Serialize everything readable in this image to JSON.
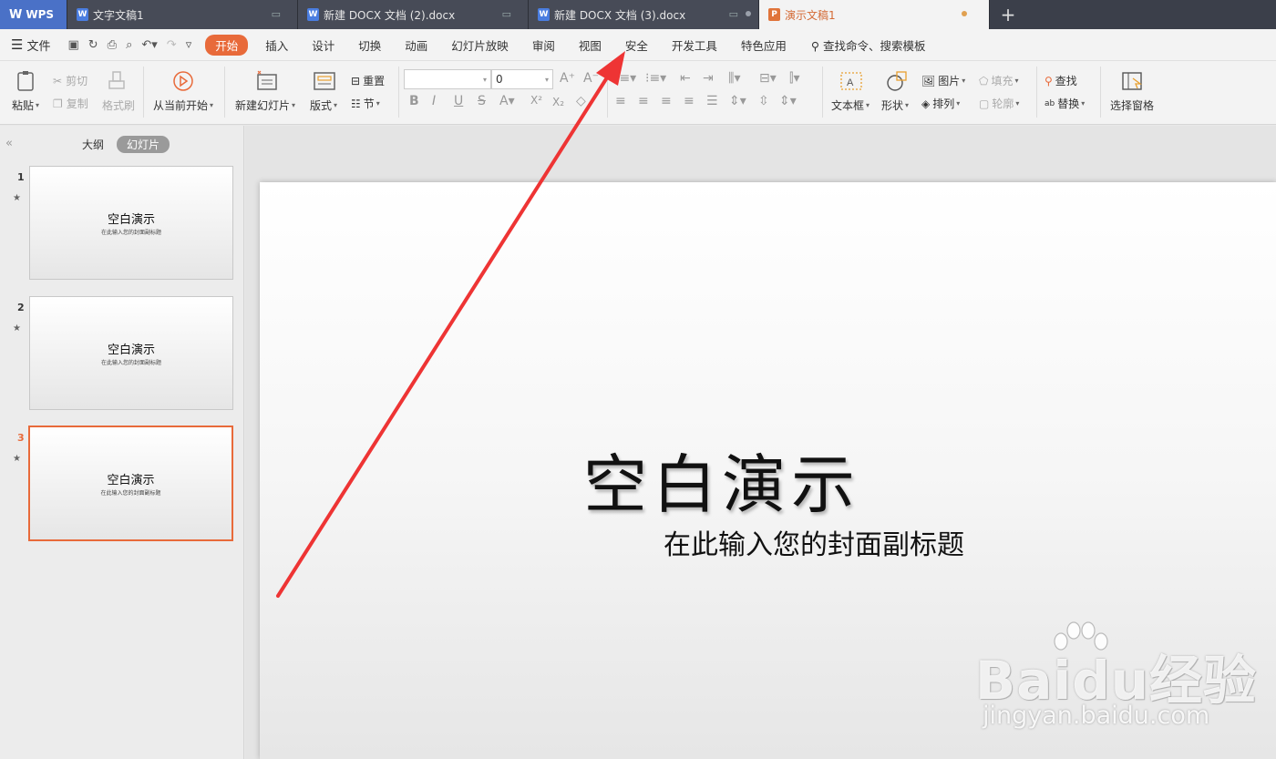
{
  "tabs": [
    {
      "label": "WPS"
    },
    {
      "label": "文字文稿1"
    },
    {
      "label": "新建 DOCX 文档 (2).docx"
    },
    {
      "label": "新建 DOCX 文档 (3).docx"
    },
    {
      "label": "演示文稿1"
    }
  ],
  "menu": {
    "file": "文件",
    "tabs": [
      "开始",
      "插入",
      "设计",
      "切换",
      "动画",
      "幻灯片放映",
      "审阅",
      "视图",
      "安全",
      "开发工具",
      "特色应用"
    ],
    "search": "查找命令、搜索模板"
  },
  "ribbon": {
    "paste": "粘贴",
    "cut": "剪切",
    "copy": "复制",
    "format_painter": "格式刷",
    "from_current": "从当前开始",
    "new_slide": "新建幻灯片",
    "layout": "版式",
    "reset": "重置",
    "section": "节",
    "font_size": "0",
    "textbox": "文本框",
    "shape": "形状",
    "picture": "图片",
    "fill": "填充",
    "arrange": "排列",
    "outline": "轮廓",
    "find": "查找",
    "replace": "替换",
    "selection_pane": "选择窗格"
  },
  "panel": {
    "outline_tab": "大纲",
    "slides_tab": "幻灯片",
    "slides": [
      {
        "num": "1",
        "title": "空白演示",
        "subtitle": "在此输入您的封面副标题"
      },
      {
        "num": "2",
        "title": "空白演示",
        "subtitle": "在此输入您的封面副标题"
      },
      {
        "num": "3",
        "title": "空白演示",
        "subtitle": "在此输入您的封面副标题"
      }
    ]
  },
  "slide": {
    "title": "空白演示",
    "subtitle": "在此输入您的封面副标题"
  },
  "watermark": {
    "logo": "Baidu经验",
    "url": "jingyan.baidu.com"
  },
  "colors": {
    "accent": "#e86a3a",
    "annotation_arrow": "#ee3434"
  }
}
